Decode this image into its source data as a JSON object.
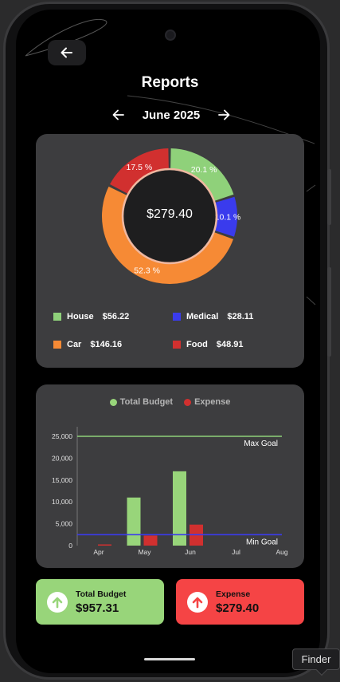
{
  "header": {
    "title": "Reports",
    "back_icon": "arrow-left-icon",
    "month": "June 2025",
    "prev_icon": "arrow-left-icon",
    "next_icon": "arrow-right-icon"
  },
  "donut": {
    "center_amount": "$279.40",
    "slices": [
      {
        "category": "House",
        "percent": 20.1,
        "label": "20.1 %",
        "color": "#8fd17a"
      },
      {
        "category": "Medical",
        "percent": 10.1,
        "label": "10.1 %",
        "color": "#3a3bed"
      },
      {
        "category": "Car",
        "percent": 52.3,
        "label": "52.3 %",
        "color": "#f68a35"
      },
      {
        "category": "Food",
        "percent": 17.5,
        "label": "17.5 %",
        "color": "#d1302f"
      }
    ],
    "legend": [
      {
        "name": "House",
        "amount": "$56.22",
        "color": "#8fd17a"
      },
      {
        "name": "Medical",
        "amount": "$28.11",
        "color": "#3a3bed"
      },
      {
        "name": "Car",
        "amount": "$146.16",
        "color": "#f68a35"
      },
      {
        "name": "Food",
        "amount": "$48.91",
        "color": "#d1302f"
      }
    ]
  },
  "bar_chart": {
    "legend": [
      {
        "name": "Total Budget",
        "color": "#98d57a"
      },
      {
        "name": "Expense",
        "color": "#d1302f"
      }
    ],
    "max_goal_label": "Max Goal",
    "min_goal_label": "Min Goal"
  },
  "chart_data": {
    "type": "bar",
    "categories": [
      "Apr",
      "May",
      "Jun",
      "Jul",
      "Aug"
    ],
    "series": [
      {
        "name": "Total Budget",
        "values": [
          0,
          11000,
          17000,
          0,
          0
        ],
        "color": "#98d57a"
      },
      {
        "name": "Expense",
        "values": [
          150,
          2300,
          4800,
          0,
          0
        ],
        "color": "#d1302f"
      }
    ],
    "reference_lines": [
      {
        "name": "Max Goal",
        "value": 25000,
        "color": "#8fd17a"
      },
      {
        "name": "Min Goal",
        "value": 2500,
        "color": "#3a3bed"
      }
    ],
    "yticks": [
      "0",
      "5,000",
      "10,000",
      "15,000",
      "20,000",
      "25,000"
    ],
    "ylim": [
      0,
      25000
    ],
    "grid": false,
    "legend_position": "top-center"
  },
  "summary": {
    "budget": {
      "label": "Total Budget",
      "value": "$957.31",
      "color": "#98d57a",
      "icon": "arrow-up-circle-icon"
    },
    "expense": {
      "label": "Expense",
      "value": "$279.40",
      "color": "#f54445",
      "icon": "arrow-up-circle-icon"
    }
  },
  "tooltip": {
    "text": "Finder"
  }
}
